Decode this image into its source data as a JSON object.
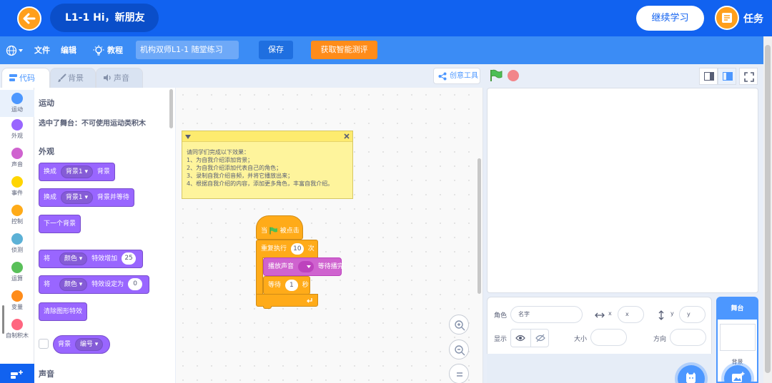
{
  "header": {
    "lesson_title": "L1-1 Hi，新朋友",
    "continue_label": "继续学习",
    "task_label": "任务",
    "brand_color": "#1162f0",
    "accent_color": "#ff9f1c"
  },
  "menu": {
    "file": "文件",
    "edit": "编辑",
    "tutorial": "教程",
    "project_title": "机构双师L1-1 随堂练习",
    "save": "保存",
    "smart_assess": "获取智能测评"
  },
  "tabs": [
    {
      "label": "代码",
      "icon": "code-icon",
      "active": true
    },
    {
      "label": "背景",
      "icon": "brush-icon",
      "active": false
    },
    {
      "label": "声音",
      "icon": "sound-icon",
      "active": false
    }
  ],
  "toolbar": {
    "creation_tool": "创意工具",
    "green_flag": "green-flag-icon",
    "stop": "stop-icon"
  },
  "categories": [
    {
      "label": "运动",
      "color": "#4c97ff"
    },
    {
      "label": "外观",
      "color": "#9966ff"
    },
    {
      "label": "声音",
      "color": "#cf63cf"
    },
    {
      "label": "事件",
      "color": "#ffd500"
    },
    {
      "label": "控制",
      "color": "#ffab19"
    },
    {
      "label": "侦测",
      "color": "#5cb1d6"
    },
    {
      "label": "运算",
      "color": "#59c059"
    },
    {
      "label": "变量",
      "color": "#ff8c1a"
    },
    {
      "label": "自制积木",
      "color": "#ff6680"
    }
  ],
  "palette": {
    "motion_heading": "运动",
    "stage_notice": "选中了舞台：不可使用运动类积木",
    "looks_heading": "外观",
    "sound_heading": "声音",
    "blocks": {
      "switch_backdrop": {
        "prefix": "换成",
        "menu": "背景1",
        "suffix": "背景"
      },
      "switch_backdrop_wait": {
        "prefix": "换成",
        "menu": "背景1",
        "suffix": "背景并等待"
      },
      "next_backdrop": "下一个背景",
      "change_effect": {
        "prefix": "将",
        "menu": "颜色",
        "suffix": "特效增加",
        "value": "25"
      },
      "set_effect": {
        "prefix": "将",
        "menu": "颜色",
        "suffix": "特效设定为",
        "value": "0"
      },
      "clear_effects": "清除图形特效",
      "backdrop_reporter": {
        "prefix": "背景",
        "menu": "编号"
      }
    }
  },
  "note": {
    "lines": [
      "请同学们完成以下效果：",
      "1、为自我介绍添加背景；",
      "2、为自我介绍添加代表自己的角色；",
      "3、录制自我介绍音频，并将它播放出来；",
      "4、根据自我介绍的内容，添加更多角色，丰富自我介绍。"
    ]
  },
  "script": {
    "when_flag_prefix": "当",
    "when_flag_suffix": "被点击",
    "repeat_prefix": "重复执行",
    "repeat_value": "10",
    "repeat_suffix": "次",
    "play_sound_prefix": "播放声音",
    "play_sound_suffix": "等待播完",
    "wait_prefix": "等待",
    "wait_value": "1",
    "wait_suffix": "秒"
  },
  "sprite_info": {
    "sprite_label": "角色",
    "name_placeholder": "名字",
    "x_label": "x",
    "x_placeholder": "x",
    "y_label": "y",
    "y_placeholder": "y",
    "show_label": "显示",
    "size_label": "大小",
    "direction_label": "方向"
  },
  "stage_panel": {
    "title": "舞台",
    "backdrops_label": "背景"
  }
}
